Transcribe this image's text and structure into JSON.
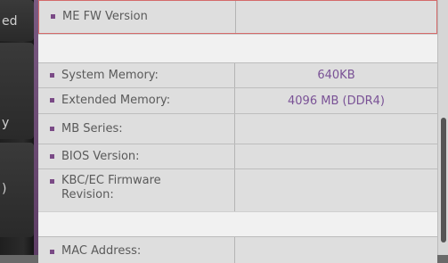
{
  "nav": {
    "fragments": [
      "ed",
      "y",
      ")"
    ]
  },
  "rows": [
    {
      "label": "ME FW Version",
      "value": ""
    },
    {
      "label": "System Memory:",
      "value": "640KB"
    },
    {
      "label": "Extended Memory:",
      "value": "4096 MB (DDR4)"
    },
    {
      "label": "MB Series:",
      "value": ""
    },
    {
      "label": "BIOS Version:",
      "value": ""
    },
    {
      "label": "KBC/EC Firmware Revision:",
      "value": ""
    },
    {
      "label": "MAC Address:",
      "value": ""
    }
  ],
  "colors": {
    "accent": "#7a4a86",
    "value_text": "#7a5296",
    "highlight_border": "#d46a6a"
  }
}
